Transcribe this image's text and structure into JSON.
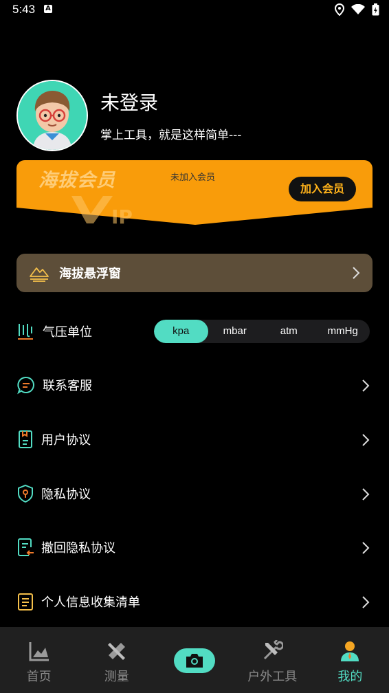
{
  "status_bar": {
    "time": "5:43",
    "notification_icon": "A"
  },
  "profile": {
    "username": "未登录",
    "slogan": "掌上工具，就是这样简单---"
  },
  "vip": {
    "title": "海拔会员",
    "status": "未加入会员",
    "join_label": "加入会员",
    "accent": "#f99c0a"
  },
  "float_window": {
    "label": "海拔悬浮窗"
  },
  "pressure_unit": {
    "label": "气压单位",
    "options": [
      "kpa",
      "mbar",
      "atm",
      "mmHg"
    ],
    "selected": "kpa"
  },
  "menu": [
    {
      "label": "联系客服",
      "icon": "chat-icon"
    },
    {
      "label": "用户协议",
      "icon": "document-icon"
    },
    {
      "label": "隐私协议",
      "icon": "shield-icon"
    },
    {
      "label": "撤回隐私协议",
      "icon": "revoke-document-icon"
    },
    {
      "label": "个人信息收集清单",
      "icon": "checklist-icon"
    }
  ],
  "bottom_nav": [
    {
      "label": "首页",
      "icon": "home-chart-icon"
    },
    {
      "label": "测量",
      "icon": "ruler-pencil-icon"
    },
    {
      "label": "",
      "icon": "camera-icon"
    },
    {
      "label": "户外工具",
      "icon": "tools-icon"
    },
    {
      "label": "我的",
      "icon": "user-icon",
      "active": true
    }
  ],
  "colors": {
    "teal": "#52dcc3",
    "background": "#000000",
    "float_card": "#5d4e39",
    "nav_bg": "#202020"
  }
}
